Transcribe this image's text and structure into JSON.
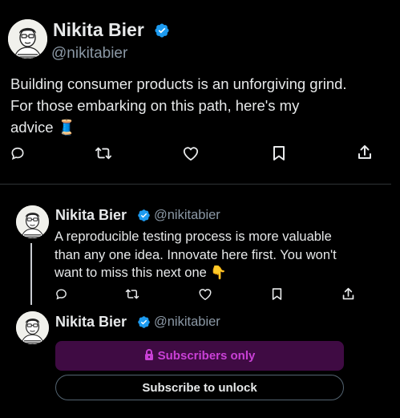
{
  "main_tweet": {
    "author_name": "Nikita Bier",
    "author_handle": "@nikitabier",
    "text_lines": [
      "Building consumer products is an unforgiving grind.",
      "For those embarking on this path, here's my",
      "advice 🧵"
    ],
    "actions": [
      "reply-icon",
      "retweet-icon",
      "like-icon",
      "bookmark-icon",
      "share-icon"
    ]
  },
  "reply_tweet": {
    "author_name": "Nikita Bier",
    "author_handle": "@nikitabier",
    "text_lines": [
      "A reproducible testing process is more valuable",
      "than any one idea. Innovate here first. You won't",
      "want to miss this next one 👇"
    ]
  },
  "locked_tweet": {
    "author_name": "Nikita Bier",
    "author_handle": "@nikitabier",
    "subscribers_label": "Subscribers only",
    "subscribe_button": "Subscribe to unlock"
  },
  "colors": {
    "background": "#000000",
    "verified_blue": "#1d9bf0",
    "subscriber_purple": "#c940d6"
  }
}
